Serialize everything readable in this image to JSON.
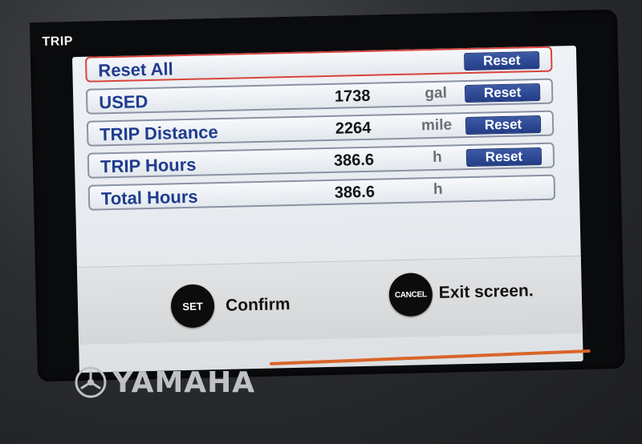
{
  "screen": {
    "title": "TRIP"
  },
  "rows": [
    {
      "label": "Reset All",
      "value": "",
      "unit": "",
      "button": "Reset",
      "selected": true
    },
    {
      "label": "USED",
      "value": "1738",
      "unit": "gal",
      "button": "Reset",
      "selected": false
    },
    {
      "label": "TRIP Distance",
      "value": "2264",
      "unit": "mile",
      "button": "Reset",
      "selected": false
    },
    {
      "label": "TRIP Hours",
      "value": "386.6",
      "unit": "h",
      "button": "Reset",
      "selected": false
    },
    {
      "label": "Total Hours",
      "value": "386.6",
      "unit": "h",
      "button": "",
      "selected": false
    }
  ],
  "footer": {
    "set_button": "SET",
    "set_caption": "Confirm",
    "cancel_button": "CANCEL",
    "cancel_caption": "Exit screen."
  },
  "brand": {
    "name": "YAMAHA",
    "logo_icon": "tuning-fork-logo-icon",
    "accent_color": "#d9652a"
  },
  "colors": {
    "label_blue": "#1f3c8f",
    "button_blue": "#2a4592",
    "selected_border": "#d9443c"
  }
}
